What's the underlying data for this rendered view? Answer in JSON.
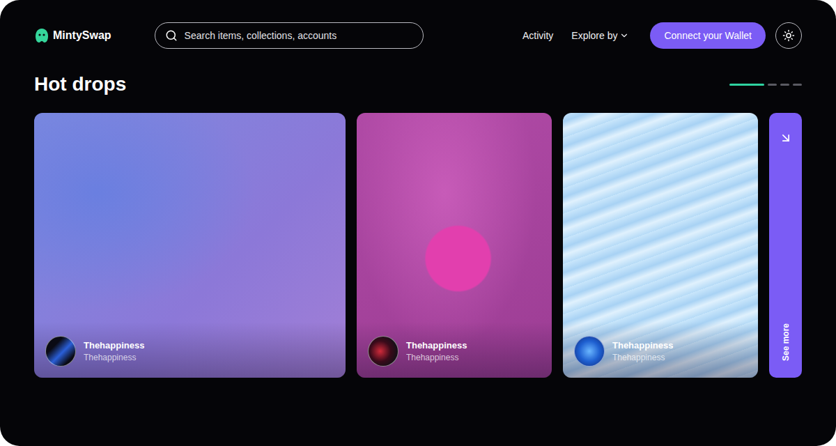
{
  "brand": {
    "name": "MintySwap"
  },
  "search": {
    "placeholder": "Search items, collections, accounts"
  },
  "nav": [
    {
      "label": "Activity",
      "kind": "link"
    },
    {
      "label": "Explore by",
      "kind": "dropdown"
    }
  ],
  "wallet_button": "Connect your Wallet",
  "section": {
    "title": "Hot drops"
  },
  "pager": [
    {
      "selected": true
    },
    {
      "selected": false
    },
    {
      "selected": false
    },
    {
      "selected": false
    }
  ],
  "cards": [
    {
      "title": "Thehappiness",
      "subtitle": "Thehappiness"
    },
    {
      "title": "Thehappiness",
      "subtitle": "Thehappiness"
    },
    {
      "title": "Thehappiness",
      "subtitle": "Thehappiness"
    }
  ],
  "see_more": "See more"
}
